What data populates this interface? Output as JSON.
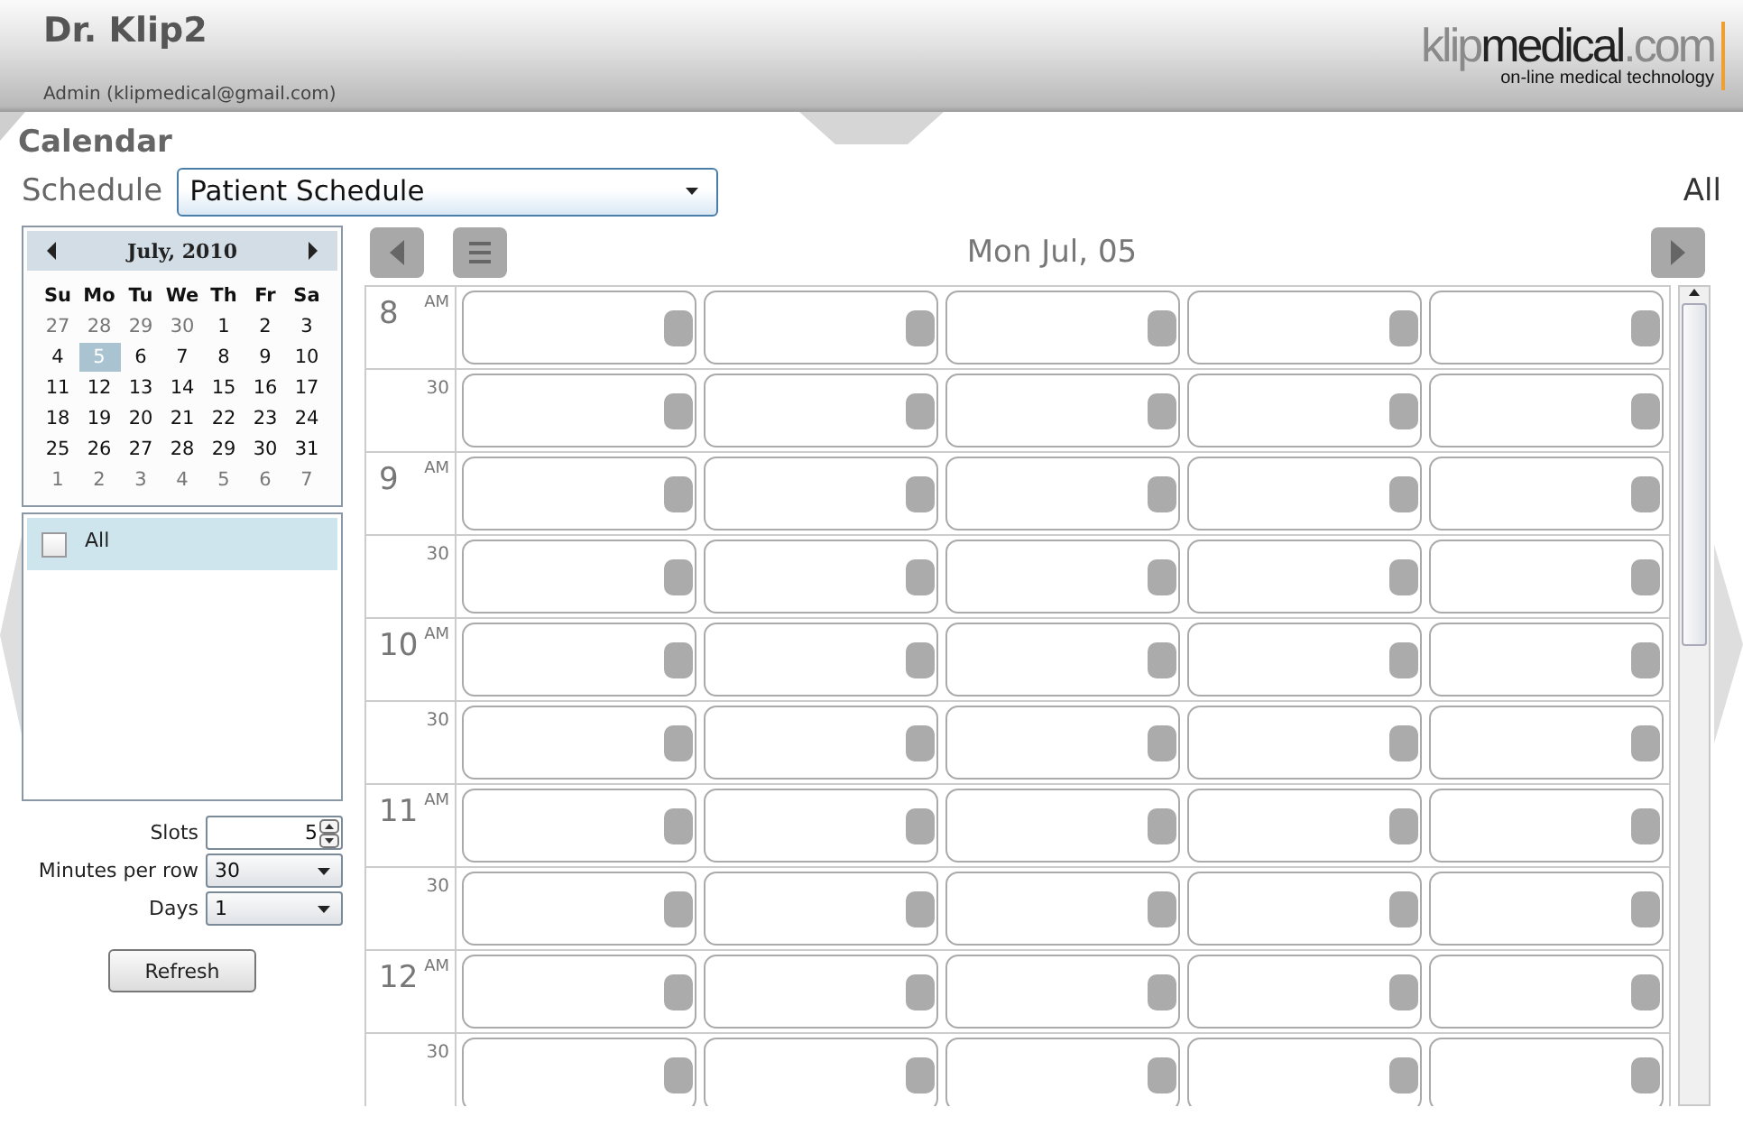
{
  "header": {
    "title": "Dr. Klip2",
    "user": "Admin (klipmedical@gmail.com)",
    "logo": {
      "parts": [
        {
          "text": "klip",
          "color": "#8a8a8a"
        },
        {
          "text": "medical",
          "color": "#222222"
        },
        {
          "text": ".com",
          "color": "#8a8a8a"
        }
      ],
      "tagline": "on-line medical technology"
    }
  },
  "page_title": "Calendar",
  "schedule": {
    "label": "Schedule",
    "value": "Patient Schedule",
    "filter": "All"
  },
  "mini_calendar": {
    "month": "July, 2010",
    "weekdays": [
      "Su",
      "Mo",
      "Tu",
      "We",
      "Th",
      "Fr",
      "Sa"
    ],
    "weeks": [
      [
        {
          "day": "27",
          "other_month": true,
          "selected": false
        },
        {
          "day": "28",
          "other_month": true,
          "selected": false
        },
        {
          "day": "29",
          "other_month": true,
          "selected": false
        },
        {
          "day": "30",
          "other_month": true,
          "selected": false
        },
        {
          "day": "1",
          "other_month": false,
          "selected": false
        },
        {
          "day": "2",
          "other_month": false,
          "selected": false
        },
        {
          "day": "3",
          "other_month": false,
          "selected": false
        }
      ],
      [
        {
          "day": "4",
          "other_month": false,
          "selected": false
        },
        {
          "day": "5",
          "other_month": false,
          "selected": true
        },
        {
          "day": "6",
          "other_month": false,
          "selected": false
        },
        {
          "day": "7",
          "other_month": false,
          "selected": false
        },
        {
          "day": "8",
          "other_month": false,
          "selected": false
        },
        {
          "day": "9",
          "other_month": false,
          "selected": false
        },
        {
          "day": "10",
          "other_month": false,
          "selected": false
        }
      ],
      [
        {
          "day": "11",
          "other_month": false,
          "selected": false
        },
        {
          "day": "12",
          "other_month": false,
          "selected": false
        },
        {
          "day": "13",
          "other_month": false,
          "selected": false
        },
        {
          "day": "14",
          "other_month": false,
          "selected": false
        },
        {
          "day": "15",
          "other_month": false,
          "selected": false
        },
        {
          "day": "16",
          "other_month": false,
          "selected": false
        },
        {
          "day": "17",
          "other_month": false,
          "selected": false
        }
      ],
      [
        {
          "day": "18",
          "other_month": false,
          "selected": false
        },
        {
          "day": "19",
          "other_month": false,
          "selected": false
        },
        {
          "day": "20",
          "other_month": false,
          "selected": false
        },
        {
          "day": "21",
          "other_month": false,
          "selected": false
        },
        {
          "day": "22",
          "other_month": false,
          "selected": false
        },
        {
          "day": "23",
          "other_month": false,
          "selected": false
        },
        {
          "day": "24",
          "other_month": false,
          "selected": false
        }
      ],
      [
        {
          "day": "25",
          "other_month": false,
          "selected": false
        },
        {
          "day": "26",
          "other_month": false,
          "selected": false
        },
        {
          "day": "27",
          "other_month": false,
          "selected": false
        },
        {
          "day": "28",
          "other_month": false,
          "selected": false
        },
        {
          "day": "29",
          "other_month": false,
          "selected": false
        },
        {
          "day": "30",
          "other_month": false,
          "selected": false
        },
        {
          "day": "31",
          "other_month": false,
          "selected": false
        }
      ],
      [
        {
          "day": "1",
          "other_month": true,
          "selected": false
        },
        {
          "day": "2",
          "other_month": true,
          "selected": false
        },
        {
          "day": "3",
          "other_month": true,
          "selected": false
        },
        {
          "day": "4",
          "other_month": true,
          "selected": false
        },
        {
          "day": "5",
          "other_month": true,
          "selected": false
        },
        {
          "day": "6",
          "other_month": true,
          "selected": false
        },
        {
          "day": "7",
          "other_month": true,
          "selected": false
        }
      ]
    ]
  },
  "resources": [
    {
      "label": "All",
      "checked": false,
      "selected": true
    }
  ],
  "controls": {
    "slots": {
      "label": "Slots",
      "value": "5"
    },
    "minutes_per_row": {
      "label": "Minutes per row",
      "value": "30"
    },
    "days": {
      "label": "Days",
      "value": "1"
    }
  },
  "refresh_button": "Refresh",
  "day_view": {
    "date": "Mon Jul, 05",
    "rows": [
      {
        "kind": "hour",
        "hour": "8",
        "suffix": "AM"
      },
      {
        "kind": "half",
        "minute": "30"
      },
      {
        "kind": "hour",
        "hour": "9",
        "suffix": "AM"
      },
      {
        "kind": "half",
        "minute": "30"
      },
      {
        "kind": "hour",
        "hour": "10",
        "suffix": "AM"
      },
      {
        "kind": "half",
        "minute": "30"
      },
      {
        "kind": "hour",
        "hour": "11",
        "suffix": "AM"
      },
      {
        "kind": "half",
        "minute": "30"
      },
      {
        "kind": "hour",
        "hour": "12",
        "suffix": "AM"
      },
      {
        "kind": "half",
        "minute": "30"
      }
    ]
  }
}
